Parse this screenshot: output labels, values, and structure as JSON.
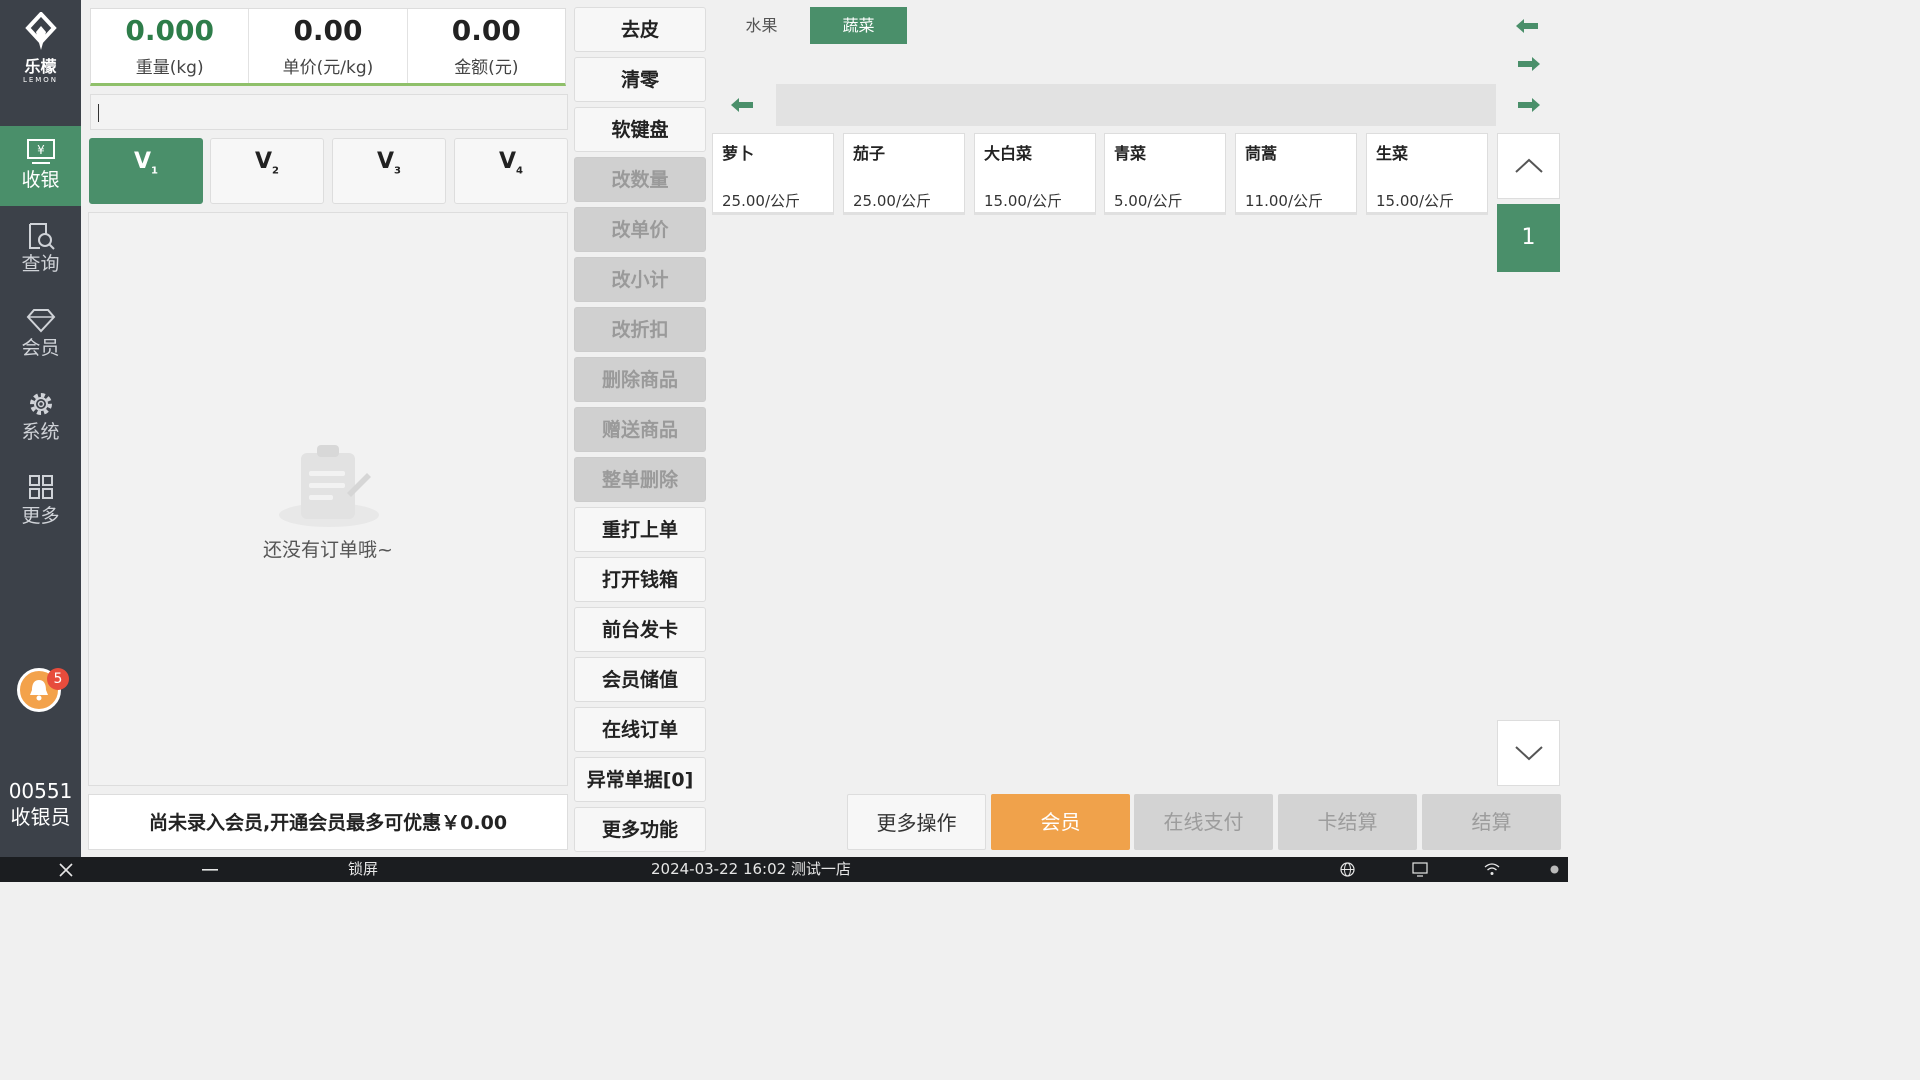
{
  "sidebar": {
    "logo_text": "乐檬",
    "logo_sub": "LEMON",
    "items": [
      {
        "label": "收银",
        "icon": "cashier-icon"
      },
      {
        "label": "查询",
        "icon": "search-doc-icon"
      },
      {
        "label": "会员",
        "icon": "diamond-icon"
      },
      {
        "label": "系统",
        "icon": "gear-icon"
      },
      {
        "label": "更多",
        "icon": "grid-icon"
      }
    ],
    "notification_count": "5",
    "cashier_id": "00551",
    "cashier_role": "收银员"
  },
  "readout": {
    "weight_value": "0.000",
    "weight_label": "重量(kg)",
    "unit_price_value": "0.00",
    "unit_price_label": "单价(元/kg)",
    "amount_value": "0.00",
    "amount_label": "金额(元)"
  },
  "vip_levels": [
    {
      "main": "V",
      "sub": "1"
    },
    {
      "main": "V",
      "sub": "2"
    },
    {
      "main": "V",
      "sub": "3"
    },
    {
      "main": "V",
      "sub": "4"
    }
  ],
  "order": {
    "empty_text": "还没有订单哦~"
  },
  "member_bar": {
    "text": "尚未录入会员,开通会员最多可优惠￥0.00"
  },
  "functions": [
    {
      "label": "去皮",
      "enabled": true
    },
    {
      "label": "清零",
      "enabled": true
    },
    {
      "label": "软键盘",
      "enabled": true
    },
    {
      "label": "改数量",
      "enabled": false
    },
    {
      "label": "改单价",
      "enabled": false
    },
    {
      "label": "改小计",
      "enabled": false
    },
    {
      "label": "改折扣",
      "enabled": false
    },
    {
      "label": "删除商品",
      "enabled": false
    },
    {
      "label": "赠送商品",
      "enabled": false
    },
    {
      "label": "整单删除",
      "enabled": false
    },
    {
      "label": "重打上单",
      "enabled": true
    },
    {
      "label": "打开钱箱",
      "enabled": true
    },
    {
      "label": "前台发卡",
      "enabled": true
    },
    {
      "label": "会员储值",
      "enabled": true
    },
    {
      "label": "在线订单",
      "enabled": true
    },
    {
      "label": "异常单据[0]",
      "enabled": true
    },
    {
      "label": "更多功能",
      "enabled": true
    }
  ],
  "categories": [
    {
      "label": "水果",
      "active": false
    },
    {
      "label": "蔬菜",
      "active": true
    }
  ],
  "products": [
    {
      "name": "萝卜",
      "price": "25.00/公斤"
    },
    {
      "name": "茄子",
      "price": "25.00/公斤"
    },
    {
      "name": "大白菜",
      "price": "15.00/公斤"
    },
    {
      "name": "青菜",
      "price": "5.00/公斤"
    },
    {
      "name": "茼蒿",
      "price": "11.00/公斤"
    },
    {
      "name": "生菜",
      "price": "15.00/公斤"
    }
  ],
  "pagination": {
    "current_page": "1"
  },
  "actions": {
    "more_ops": "更多操作",
    "member": "会员",
    "online_pay": "在线支付",
    "card_settle": "卡结算",
    "settle": "结算"
  },
  "taskbar": {
    "lock_label": "锁屏",
    "datetime_store": "2024-03-22 16:02 测试一店"
  },
  "colors": {
    "sidebar_bg": "#3c4149",
    "accent_green": "#4a8f6a",
    "member_orange": "#f0a24b",
    "disabled_gray": "#d0d0d0"
  }
}
